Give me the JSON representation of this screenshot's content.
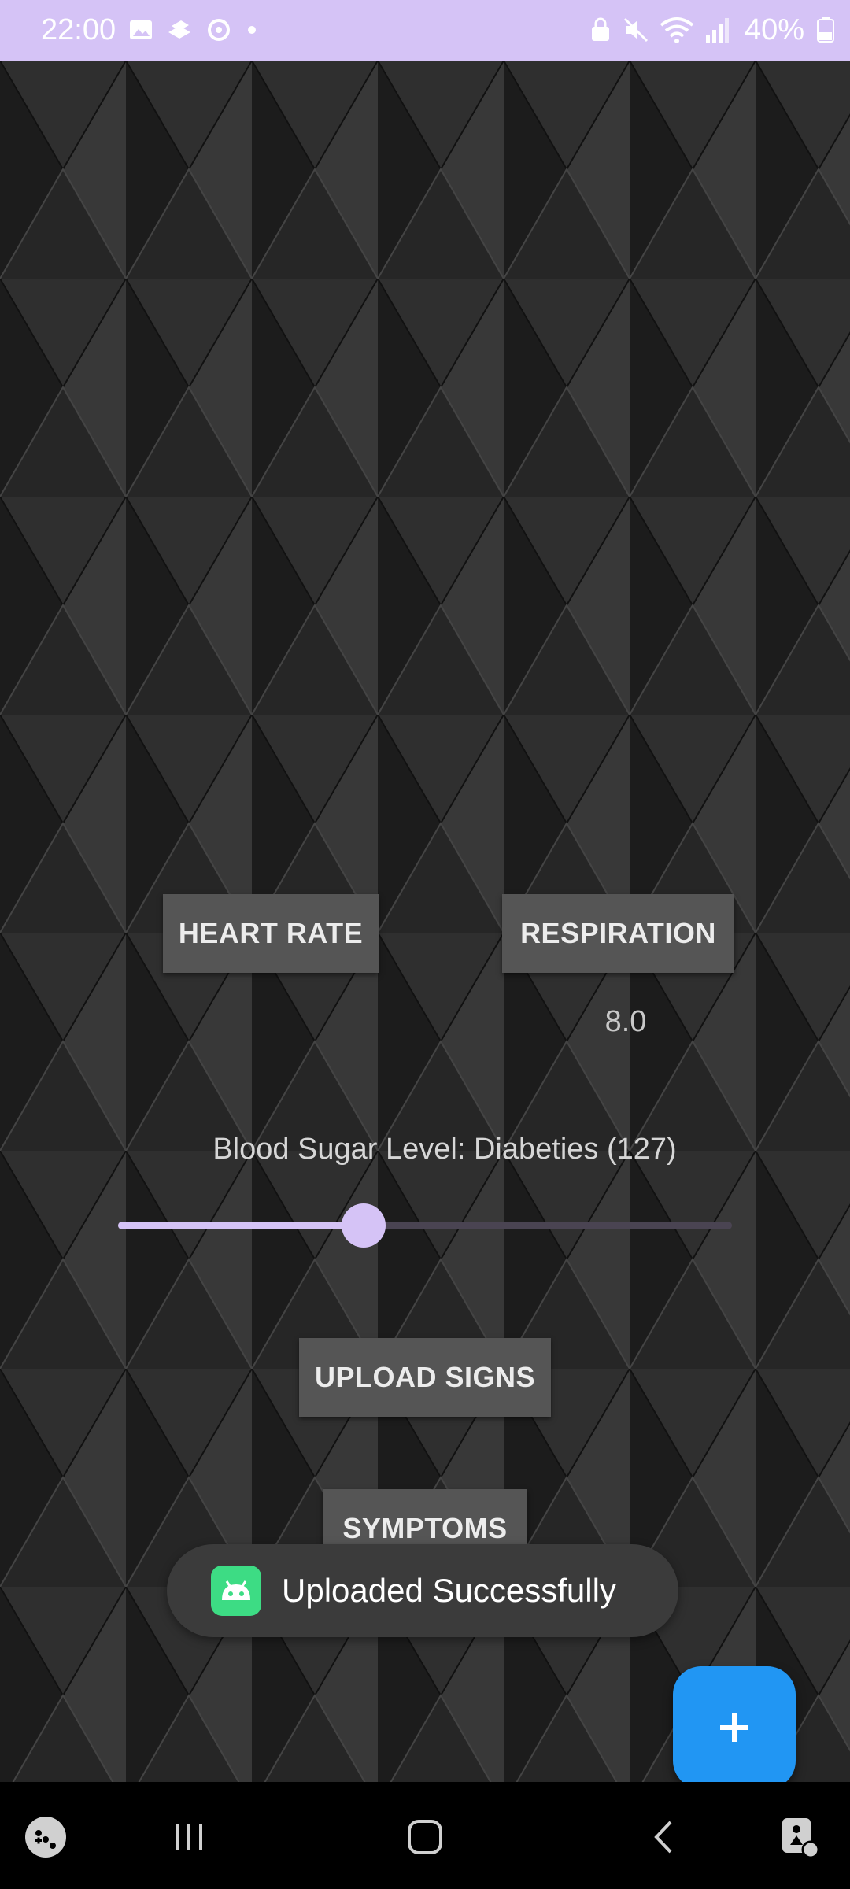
{
  "status_bar": {
    "time": "22:00",
    "battery": "40%",
    "left_icons": [
      "gallery-icon",
      "stack-icon",
      "sync-icon",
      "dot-icon"
    ],
    "right_icons": [
      "lock-icon",
      "mute-icon",
      "wifi-icon",
      "signal-icon"
    ]
  },
  "vitals": {
    "heart_rate_label": "HEART RATE",
    "respiration_label": "RESPIRATION",
    "respiration_value": "8.0",
    "blood_sugar_label": "Blood Sugar Level: Diabeties (127)",
    "blood_sugar_slider_fraction": 0.4
  },
  "actions": {
    "upload_label": "UPLOAD SIGNS",
    "symptoms_label": "SYMPTOMS"
  },
  "toast": {
    "message": "Uploaded Successfully",
    "icon": "android-icon"
  },
  "fab": {
    "icon": "plus-icon",
    "color": "#2196F3"
  },
  "nav_bar": {
    "items": [
      "game-launcher-icon",
      "recents-icon",
      "home-icon",
      "back-icon",
      "accessibility-icon"
    ]
  },
  "colors": {
    "status_bar": "#D5C3F6",
    "accent": "#D5C3F6",
    "button": "#555555"
  }
}
